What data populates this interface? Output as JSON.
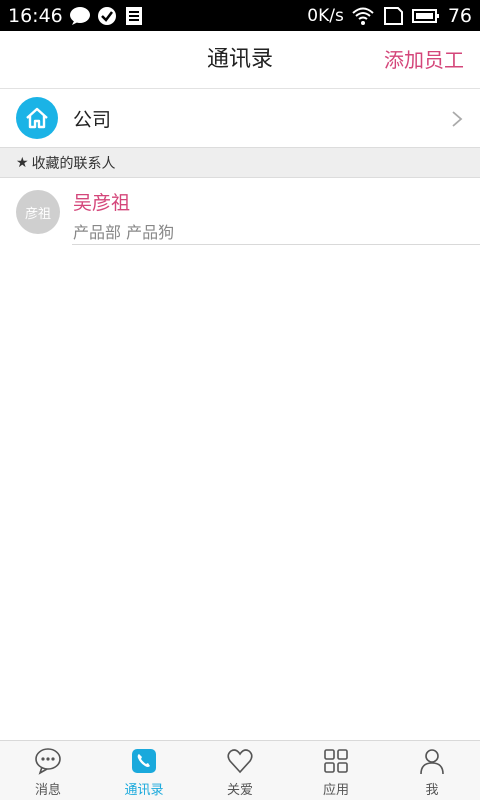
{
  "status_bar": {
    "time": "16:46",
    "data_rate": "0K/s",
    "battery": "76"
  },
  "header": {
    "title": "通讯录",
    "action_label": "添加员工"
  },
  "company_row": {
    "label": "公司"
  },
  "favorites": {
    "section_title": "收藏的联系人",
    "contacts": [
      {
        "avatar_text": "彦祖",
        "name": "吴彦祖",
        "department": "产品部 产品狗"
      }
    ]
  },
  "tabbar": {
    "tabs": [
      {
        "label": "消息",
        "icon": "chat-bubble-icon",
        "active": false
      },
      {
        "label": "通讯录",
        "icon": "phone-book-icon",
        "active": true
      },
      {
        "label": "关爱",
        "icon": "heart-icon",
        "active": false
      },
      {
        "label": "应用",
        "icon": "apps-grid-icon",
        "active": false
      },
      {
        "label": "我",
        "icon": "person-icon",
        "active": false
      }
    ]
  },
  "colors": {
    "accent_pink": "#d4467a",
    "accent_blue": "#1bb3e6",
    "status_bar": "#000000"
  }
}
